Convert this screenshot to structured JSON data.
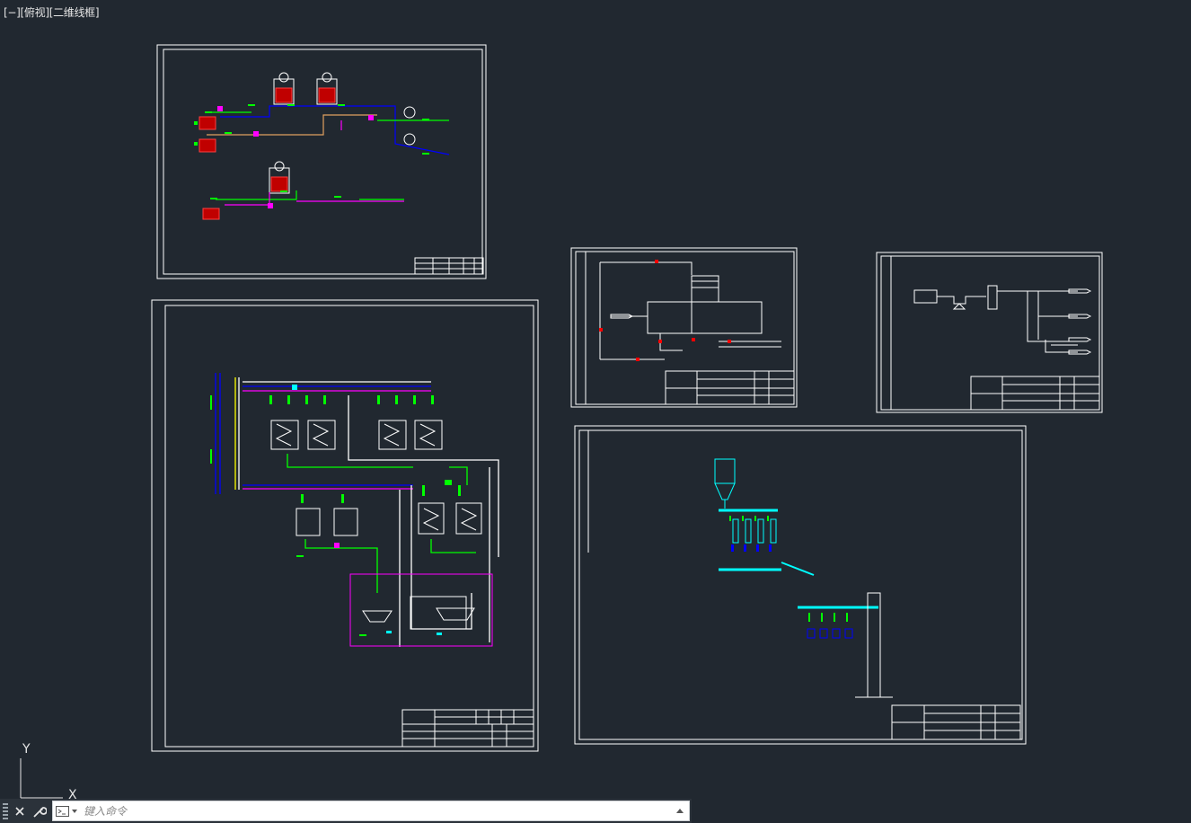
{
  "viewport": {
    "controls": "[−]",
    "view": "[俯视]",
    "visual_style": "[二维线框]"
  },
  "command_line": {
    "placeholder": "键入命令"
  },
  "ucs": {
    "y_label": "Y",
    "x_label": "X"
  },
  "icons": {
    "grip": "grip-icon",
    "close": "close-icon",
    "customize": "wrench-icon",
    "prompt": "command-prompt-icon",
    "history": "history-arrow-icon"
  },
  "colors": {
    "background": "#212830",
    "sheet_border": "#ffffff",
    "pipe_green": "#00ff00",
    "pipe_blue": "#0000ff",
    "pipe_magenta": "#ff00ff",
    "pipe_yellow": "#ffff00",
    "vessel_red": "#ff0000",
    "cyan": "#00ffff"
  }
}
